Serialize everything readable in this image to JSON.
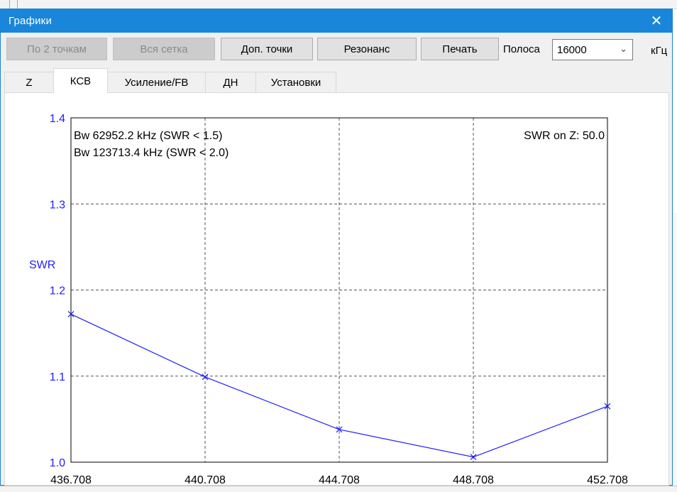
{
  "window": {
    "title": "Графики",
    "close_glyph": "✕"
  },
  "toolbar": {
    "buttons": [
      {
        "label": "По 2 точкам",
        "enabled": false
      },
      {
        "label": "Вся сетка",
        "enabled": false
      },
      {
        "label": "Доп. точки",
        "enabled": true
      },
      {
        "label": "Резонанс",
        "enabled": true
      },
      {
        "label": "Печать",
        "enabled": true
      }
    ],
    "band_label": "Полоса",
    "band_value": "16000",
    "unit_label": "кГц"
  },
  "tabs": [
    {
      "label": "Z",
      "active": false
    },
    {
      "label": "КСВ",
      "active": true
    },
    {
      "label": "Усиление/FB",
      "active": false
    },
    {
      "label": "ДН",
      "active": false
    },
    {
      "label": "Установки",
      "active": false
    }
  ],
  "icons": {
    "close": "close-icon",
    "dropdown": "chevron-down-icon"
  },
  "colors": {
    "titlebar": "#1a86d9",
    "axis_text": "#2020ff",
    "series": "#2020ff"
  },
  "chart_data": {
    "type": "line",
    "title": "",
    "xlabel": "",
    "ylabel": "SWR",
    "annotations": [
      "Bw 62952.2 kHz (SWR < 1.5)",
      "Bw 123713.4 kHz (SWR < 2.0)",
      "SWR on Z: 50.0"
    ],
    "x_ticks": [
      "436.708",
      "440.708",
      "444.708",
      "448.708",
      "452.708"
    ],
    "y_ticks": [
      "1.0",
      "1.1",
      "1.2",
      "1.3",
      "1.4"
    ],
    "xlim": [
      436.708,
      452.708
    ],
    "ylim": [
      1.0,
      1.4
    ],
    "grid": true,
    "series": [
      {
        "marker": "x",
        "x": [
          436.708,
          440.708,
          444.708,
          448.708,
          452.708
        ],
        "y": [
          1.172,
          1.099,
          1.038,
          1.006,
          1.065
        ]
      }
    ]
  }
}
